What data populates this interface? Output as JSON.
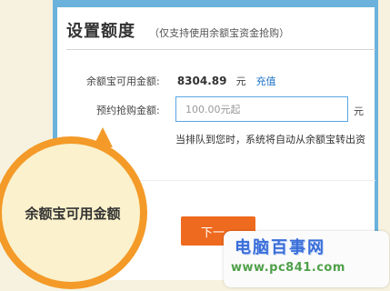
{
  "panel": {
    "title": "设置额度",
    "subtitle": "（仅支持使用余额宝资金抢购）"
  },
  "balance": {
    "label": "余额宝可用金额:",
    "amount": "8304.89",
    "unit": "元",
    "recharge_link": "充值"
  },
  "reserve": {
    "label": "预约抢购金额:",
    "placeholder": "100.00元起",
    "unit": "元"
  },
  "hint": "当排队到您时，系统将自动从余额宝转出资",
  "next_button": "下一",
  "tooltip": {
    "text": "余额宝可用金额"
  },
  "watermark": {
    "title": "电脑百事网",
    "url": "www.pc841.com"
  },
  "colors": {
    "panel_border": "#6ab2dc",
    "button": "#ee6a1e",
    "bubble_ring": "#f39a28",
    "link": "#1f74c6"
  }
}
